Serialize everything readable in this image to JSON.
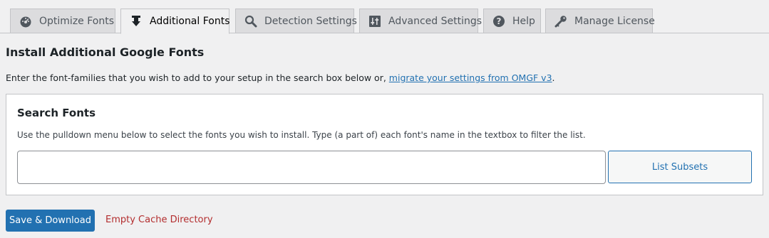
{
  "tabs": [
    {
      "label": "Optimize Fonts",
      "icon": "dashboard-icon",
      "active": false
    },
    {
      "label": "Additional Fonts",
      "icon": "download-icon",
      "active": true
    },
    {
      "label": "Detection Settings",
      "icon": "search-icon",
      "active": false
    },
    {
      "label": "Advanced Settings",
      "icon": "settings-sliders-icon",
      "active": false
    },
    {
      "label": "Help",
      "icon": "help-icon",
      "active": false
    },
    {
      "label": "Manage License",
      "icon": "key-icon",
      "active": false
    }
  ],
  "page": {
    "title": "Install Additional Google Fonts",
    "intro_text": "Enter the font-families that you wish to add to your setup in the search box below or, ",
    "intro_link": "migrate your settings from OMGF v3",
    "intro_end": "."
  },
  "search_panel": {
    "title": "Search Fonts",
    "description": "Use the pulldown menu below to select the fonts you wish to install. Type (a part of) each font's name in the textbox to filter the list.",
    "input_value": "",
    "list_subsets_label": "List Subsets"
  },
  "footer": {
    "save_label": "Save & Download",
    "empty_cache_label": "Empty Cache Directory"
  },
  "colors": {
    "accent": "#2271b1",
    "danger": "#b32d2e",
    "background": "#f0f0f1"
  }
}
